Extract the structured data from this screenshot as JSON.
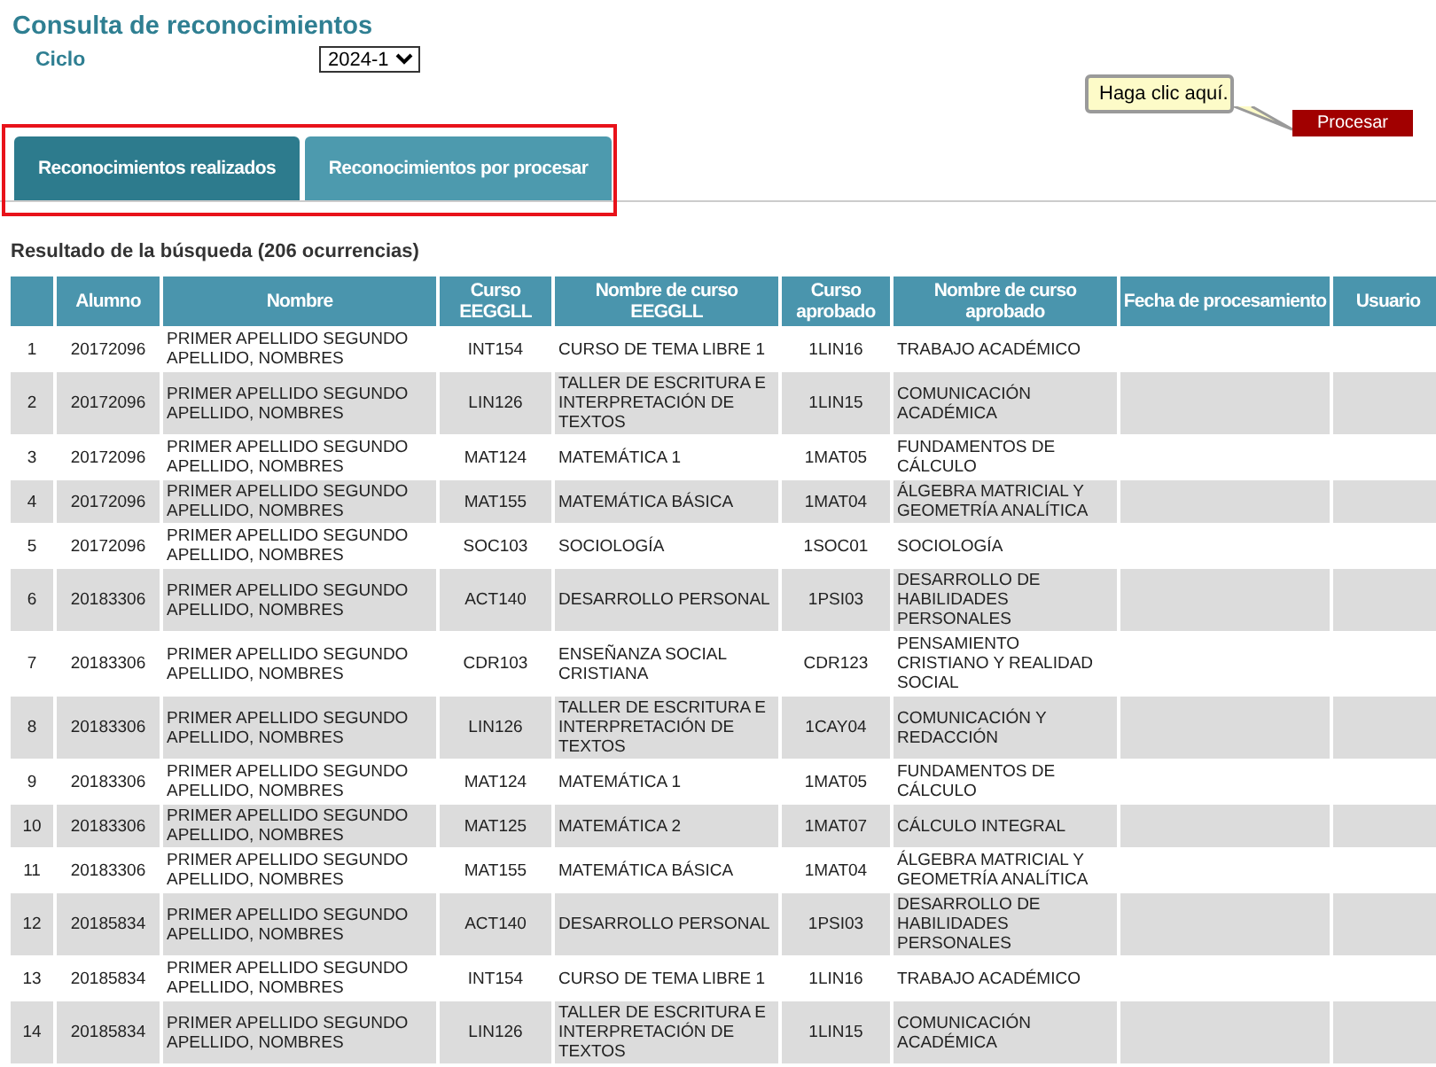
{
  "title": "Consulta de reconocimientos",
  "ciclo": {
    "label": "Ciclo",
    "value": "2024-1"
  },
  "tooltip": "Haga clic aquí.",
  "process_button": "Procesar",
  "tabs": [
    {
      "label": "Reconocimientos realizados",
      "selected": true
    },
    {
      "label": "Reconocimientos por procesar",
      "selected": false
    }
  ],
  "result_title": "Resultado de la búsqueda (206 ocurrencias)",
  "table": {
    "columns": [
      "",
      "Alumno",
      "Nombre",
      "Curso\nEEGGLL",
      "Nombre de curso\nEEGGLL",
      "Curso\naprobado",
      "Nombre de curso\naprobado",
      "Fecha de procesamiento",
      "Usuario"
    ],
    "rows": [
      [
        "1",
        "20172096",
        "PRIMER APELLIDO SEGUNDO APELLIDO, NOMBRES",
        "INT154",
        "CURSO DE TEMA LIBRE 1",
        "1LIN16",
        "TRABAJO ACADÉMICO"
      ],
      [
        "2",
        "20172096",
        "PRIMER APELLIDO SEGUNDO APELLIDO, NOMBRES",
        "LIN126",
        "TALLER DE ESCRITURA E INTERPRETACIÓN DE TEXTOS",
        "1LIN15",
        "COMUNICACIÓN ACADÉMICA"
      ],
      [
        "3",
        "20172096",
        "PRIMER APELLIDO SEGUNDO APELLIDO, NOMBRES",
        "MAT124",
        "MATEMÁTICA 1",
        "1MAT05",
        "FUNDAMENTOS DE CÁLCULO"
      ],
      [
        "4",
        "20172096",
        "PRIMER APELLIDO SEGUNDO APELLIDO, NOMBRES",
        "MAT155",
        "MATEMÁTICA BÁSICA",
        "1MAT04",
        "ÁLGEBRA MATRICIAL Y GEOMETRÍA ANALÍTICA"
      ],
      [
        "5",
        "20172096",
        "PRIMER APELLIDO SEGUNDO APELLIDO, NOMBRES",
        "SOC103",
        "SOCIOLOGÍA",
        "1SOC01",
        "SOCIOLOGÍA"
      ],
      [
        "6",
        "20183306",
        "PRIMER APELLIDO SEGUNDO APELLIDO, NOMBRES",
        "ACT140",
        "DESARROLLO PERSONAL",
        "1PSI03",
        "DESARROLLO DE HABILIDADES PERSONALES"
      ],
      [
        "7",
        "20183306",
        "PRIMER APELLIDO SEGUNDO APELLIDO, NOMBRES",
        "CDR103",
        "ENSEÑANZA SOCIAL CRISTIANA",
        "CDR123",
        "PENSAMIENTO CRISTIANO Y REALIDAD SOCIAL"
      ],
      [
        "8",
        "20183306",
        "PRIMER APELLIDO SEGUNDO APELLIDO, NOMBRES",
        "LIN126",
        "TALLER DE ESCRITURA E INTERPRETACIÓN DE TEXTOS",
        "1CAY04",
        "COMUNICACIÓN Y REDACCIÓN"
      ],
      [
        "9",
        "20183306",
        "PRIMER APELLIDO SEGUNDO APELLIDO, NOMBRES",
        "MAT124",
        "MATEMÁTICA 1",
        "1MAT05",
        "FUNDAMENTOS DE CÁLCULO"
      ],
      [
        "10",
        "20183306",
        "PRIMER APELLIDO SEGUNDO APELLIDO, NOMBRES",
        "MAT125",
        "MATEMÁTICA 2",
        "1MAT07",
        "CÁLCULO INTEGRAL"
      ],
      [
        "11",
        "20183306",
        "PRIMER APELLIDO SEGUNDO APELLIDO, NOMBRES",
        "MAT155",
        "MATEMÁTICA BÁSICA",
        "1MAT04",
        "ÁLGEBRA MATRICIAL Y GEOMETRÍA ANALÍTICA"
      ],
      [
        "12",
        "20185834",
        "PRIMER APELLIDO SEGUNDO APELLIDO, NOMBRES",
        "ACT140",
        "DESARROLLO PERSONAL",
        "1PSI03",
        "DESARROLLO DE HABILIDADES PERSONALES"
      ],
      [
        "13",
        "20185834",
        "PRIMER APELLIDO SEGUNDO APELLIDO, NOMBRES",
        "INT154",
        "CURSO DE TEMA LIBRE 1",
        "1LIN16",
        "TRABAJO ACADÉMICO"
      ],
      [
        "14",
        "20185834",
        "PRIMER APELLIDO SEGUNDO APELLIDO, NOMBRES",
        "LIN126",
        "TALLER DE ESCRITURA E INTERPRETACIÓN DE TEXTOS",
        "1LIN15",
        "COMUNICACIÓN ACADÉMICA"
      ]
    ]
  }
}
